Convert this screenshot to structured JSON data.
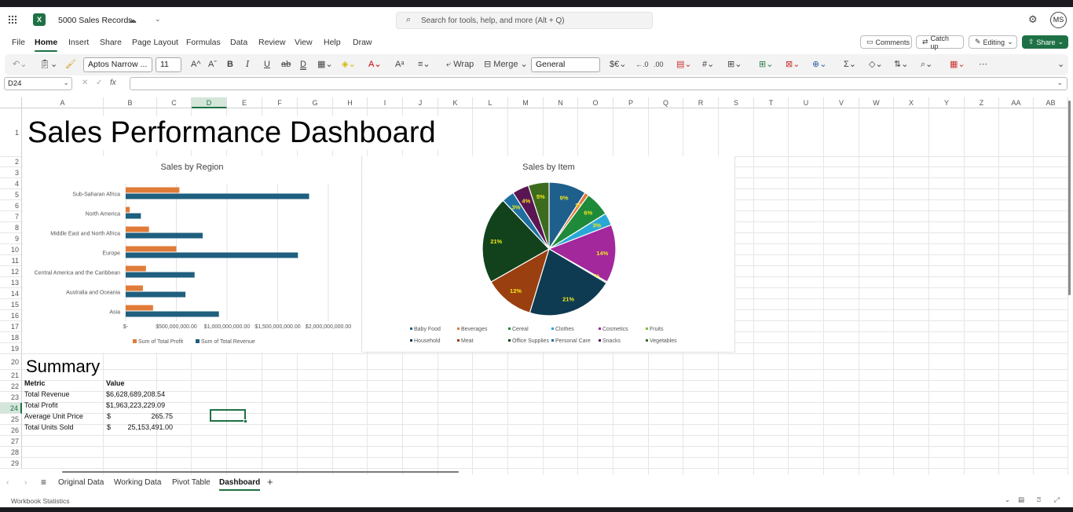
{
  "window": {
    "file_name": "5000 Sales Records",
    "search_placeholder": "Search for tools, help, and more (Alt + Q)",
    "user_initials": "MS"
  },
  "menu": [
    "File",
    "Home",
    "Insert",
    "Share",
    "Page Layout",
    "Formulas",
    "Data",
    "Review",
    "View",
    "Help",
    "Draw"
  ],
  "actions": {
    "comments": "Comments",
    "catch_up": "Catch up",
    "editing": "Editing",
    "share": "Share"
  },
  "ribbon": {
    "font_name": "Aptos Narrow ...",
    "font_size": "11",
    "wrap": "Wrap",
    "merge": "Merge",
    "number_format": "General"
  },
  "formula_bar": {
    "name_box": "D24",
    "fx": "fx",
    "formula": ""
  },
  "columns": [
    "A",
    "B",
    "C",
    "D",
    "E",
    "F",
    "G",
    "H",
    "I",
    "J",
    "K",
    "L",
    "M",
    "N",
    "O",
    "P",
    "Q",
    "R",
    "S",
    "T",
    "U",
    "V",
    "W",
    "X",
    "Y",
    "Z",
    "AA",
    "AB"
  ],
  "rows": [
    "1",
    "2",
    "3",
    "4",
    "5",
    "6",
    "7",
    "8",
    "9",
    "10",
    "11",
    "12",
    "13",
    "14",
    "15",
    "16",
    "17",
    "18",
    "19",
    "20",
    "21",
    "22",
    "23",
    "24",
    "25",
    "26",
    "27",
    "28",
    "29"
  ],
  "sheet": {
    "title": "Sales Performance Dashboard",
    "summary_heading": "Summary",
    "summary_headers": [
      "Metric",
      "Value"
    ],
    "summary_rows": [
      {
        "metric": "Total Revenue",
        "value": "$6,628,689,208.54"
      },
      {
        "metric": "Total Profit",
        "value": "$1,963,223,229.09"
      },
      {
        "metric": "Average Unit Price",
        "currency": "$",
        "value": "265.75"
      },
      {
        "metric": "Total Units Sold",
        "currency": "$",
        "value": "25,153,491.00"
      }
    ]
  },
  "chart_data": [
    {
      "type": "bar",
      "orientation": "horizontal",
      "title": "Sales by Region",
      "categories": [
        "Asia",
        "Australia and Oceania",
        "Central America and the Caribbean",
        "Europe",
        "Middle East and North Africa",
        "North America",
        "Sub-Saharan Africa"
      ],
      "series": [
        {
          "name": "Sum of Total Profit",
          "color": "#e07b39",
          "values": [
            270000000,
            170000000,
            200000000,
            500000000,
            230000000,
            40000000,
            530000000
          ]
        },
        {
          "name": "Sum of Total Revenue",
          "color": "#1f5f7f",
          "values": [
            920000000,
            590000000,
            680000000,
            1700000000,
            760000000,
            150000000,
            1810000000
          ]
        }
      ],
      "x_ticks": [
        "$-",
        "$500,000,000.00",
        "$1,000,000,000.00",
        "$1,500,000,000.00",
        "$2,000,000,000.00"
      ],
      "xlim": [
        0,
        2000000000
      ],
      "legend": "bottom"
    },
    {
      "type": "pie",
      "title": "Sales by Item",
      "slices": [
        {
          "name": "Baby Food",
          "value": 9,
          "label": "9%",
          "color": "#1f5f8b"
        },
        {
          "name": "Beverages",
          "value": 1,
          "label": "1%",
          "color": "#e07b39"
        },
        {
          "name": "Cereal",
          "value": 6,
          "label": "6%",
          "color": "#1f8a3a"
        },
        {
          "name": "Clothes",
          "value": 3,
          "label": "3%",
          "color": "#29a8d6"
        },
        {
          "name": "Cosmetics",
          "value": 14,
          "label": "14%",
          "color": "#a3289c"
        },
        {
          "name": "Fruits",
          "value": 0.3,
          "label": "0%",
          "color": "#7cbf3f"
        },
        {
          "name": "Household",
          "value": 21,
          "label": "21%",
          "color": "#0e3a52"
        },
        {
          "name": "Meat",
          "value": 12,
          "label": "12%",
          "color": "#9a3f0f"
        },
        {
          "name": "Office Supplies",
          "value": 21,
          "label": "21%",
          "color": "#12421c"
        },
        {
          "name": "Personal Care",
          "value": 3,
          "label": "3%",
          "color": "#1f6fa0"
        },
        {
          "name": "Snacks",
          "value": 4,
          "label": "4%",
          "color": "#5a1652"
        },
        {
          "name": "Vegetables",
          "value": 5,
          "label": "5%",
          "color": "#3d6b1e"
        }
      ],
      "legend": "bottom"
    }
  ],
  "sheet_tabs": [
    "Original Data",
    "Working Data",
    "Pivot Table",
    "Dashboard"
  ],
  "active_tab": "Dashboard",
  "status": {
    "workbook_statistics": "Workbook Statistics"
  }
}
